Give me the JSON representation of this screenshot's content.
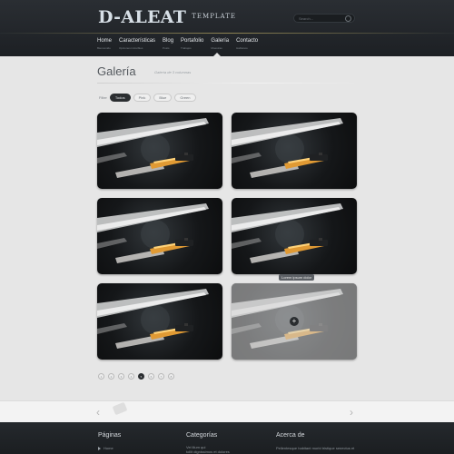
{
  "header": {
    "logo": "D-ALEAT",
    "logo_suffix": "TEMPLATE",
    "search_placeholder": "Search..."
  },
  "nav": [
    {
      "label": "Home",
      "sub": "Bienvenido"
    },
    {
      "label": "Características",
      "sub": "Opciones increíbles"
    },
    {
      "label": "Blog",
      "sub": "Posts"
    },
    {
      "label": "Portafolio",
      "sub": "Trabajos"
    },
    {
      "label": "Galería",
      "sub": "Muestras"
    },
    {
      "label": "Contacto",
      "sub": "Hablanos"
    }
  ],
  "page": {
    "title": "Galería",
    "subtitle": "Galería de 3 columnas"
  },
  "filters": {
    "label": "Filter",
    "options": [
      "Todos",
      "Pink",
      "Blue",
      "Green"
    ],
    "active": "Todos"
  },
  "gallery": {
    "tooltip": "Lorem ipsum dolor",
    "hover_icon": "plus-icon",
    "items": 6
  },
  "pagination": {
    "pages": [
      "1",
      "2",
      "3",
      "4",
      "5",
      "6",
      "7",
      "8"
    ],
    "current": "5"
  },
  "footer": {
    "col1_title": "Páginas",
    "col1_item": "Home",
    "col2_title": "Categorías",
    "col2_item": "Vel illum qui",
    "col2_item2": "tollit dignissimos et dolores",
    "col3_title": "Acerca de",
    "col3_text": "Pellentesque habitant morbi tristique senectus et"
  },
  "colors": {
    "header_bg": "#25292d",
    "accent_line": "#c9b56a",
    "body_bg": "#e6e6e6"
  }
}
